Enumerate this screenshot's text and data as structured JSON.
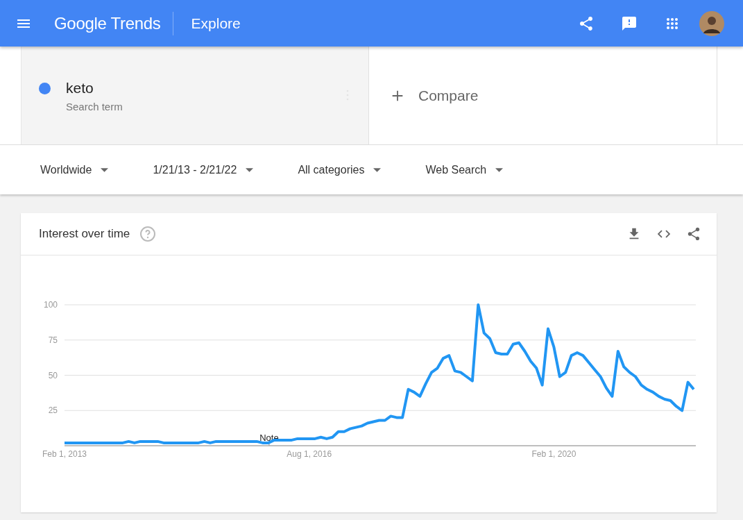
{
  "header": {
    "logo": "Google Trends",
    "page_title": "Explore"
  },
  "search_terms": [
    {
      "term": "keto",
      "subtitle": "Search term",
      "color": "#4285f4"
    }
  ],
  "compare": {
    "label": "Compare"
  },
  "filters": [
    {
      "label": "Worldwide"
    },
    {
      "label": "1/21/13 - 2/21/22"
    },
    {
      "label": "All categories"
    },
    {
      "label": "Web Search"
    }
  ],
  "interest_over_time": {
    "title": "Interest over time",
    "chart_data": {
      "type": "line",
      "categories": [
        "Feb 1, 2013",
        null,
        null,
        null,
        null,
        null,
        null,
        null,
        null,
        null,
        null,
        null,
        null,
        null,
        null,
        null,
        null,
        null,
        null,
        null,
        null,
        null,
        null,
        null,
        null,
        null,
        null,
        null,
        null,
        null,
        null,
        null,
        null,
        null,
        null,
        null,
        null,
        null,
        null,
        null,
        null,
        null,
        "Aug 1, 2016",
        null,
        null,
        null,
        null,
        null,
        null,
        null,
        null,
        null,
        null,
        null,
        null,
        null,
        null,
        null,
        null,
        null,
        null,
        null,
        null,
        null,
        null,
        null,
        null,
        null,
        null,
        null,
        null,
        null,
        null,
        null,
        null,
        null,
        null,
        null,
        null,
        null,
        null,
        null,
        null,
        null,
        "Feb 1, 2020",
        null,
        null,
        null,
        null,
        null,
        null,
        null,
        null,
        null,
        null,
        null,
        null,
        null,
        null,
        null,
        null,
        null,
        null,
        null,
        null,
        null,
        null,
        null,
        null
      ],
      "series": [
        {
          "color": "#2196f3",
          "values": [
            2,
            2,
            2,
            2,
            2,
            2,
            2,
            2,
            2,
            2,
            2,
            3,
            2,
            3,
            3,
            3,
            3,
            2,
            2,
            2,
            2,
            2,
            2,
            2,
            3,
            2,
            3,
            3,
            3,
            3,
            3,
            3,
            3,
            3,
            2,
            2,
            4,
            4,
            4,
            4,
            5,
            5,
            5,
            5,
            6,
            5,
            6,
            10,
            10,
            12,
            13,
            14,
            16,
            17,
            18,
            18,
            21,
            20,
            20,
            40,
            38,
            35,
            44,
            52,
            55,
            62,
            64,
            53,
            52,
            49,
            46,
            100,
            80,
            76,
            66,
            65,
            65,
            72,
            73,
            67,
            60,
            55,
            43,
            83,
            70,
            49,
            52,
            64,
            66,
            64,
            59,
            54,
            49,
            41,
            35,
            67,
            56,
            52,
            49,
            43,
            40,
            38,
            35,
            33,
            32,
            28,
            25,
            45,
            40
          ]
        }
      ],
      "ylim": [
        0,
        100
      ],
      "yticks": [
        25,
        50,
        75,
        100
      ],
      "grid": true,
      "annotations": [
        {
          "text": "Note"
        }
      ]
    }
  }
}
